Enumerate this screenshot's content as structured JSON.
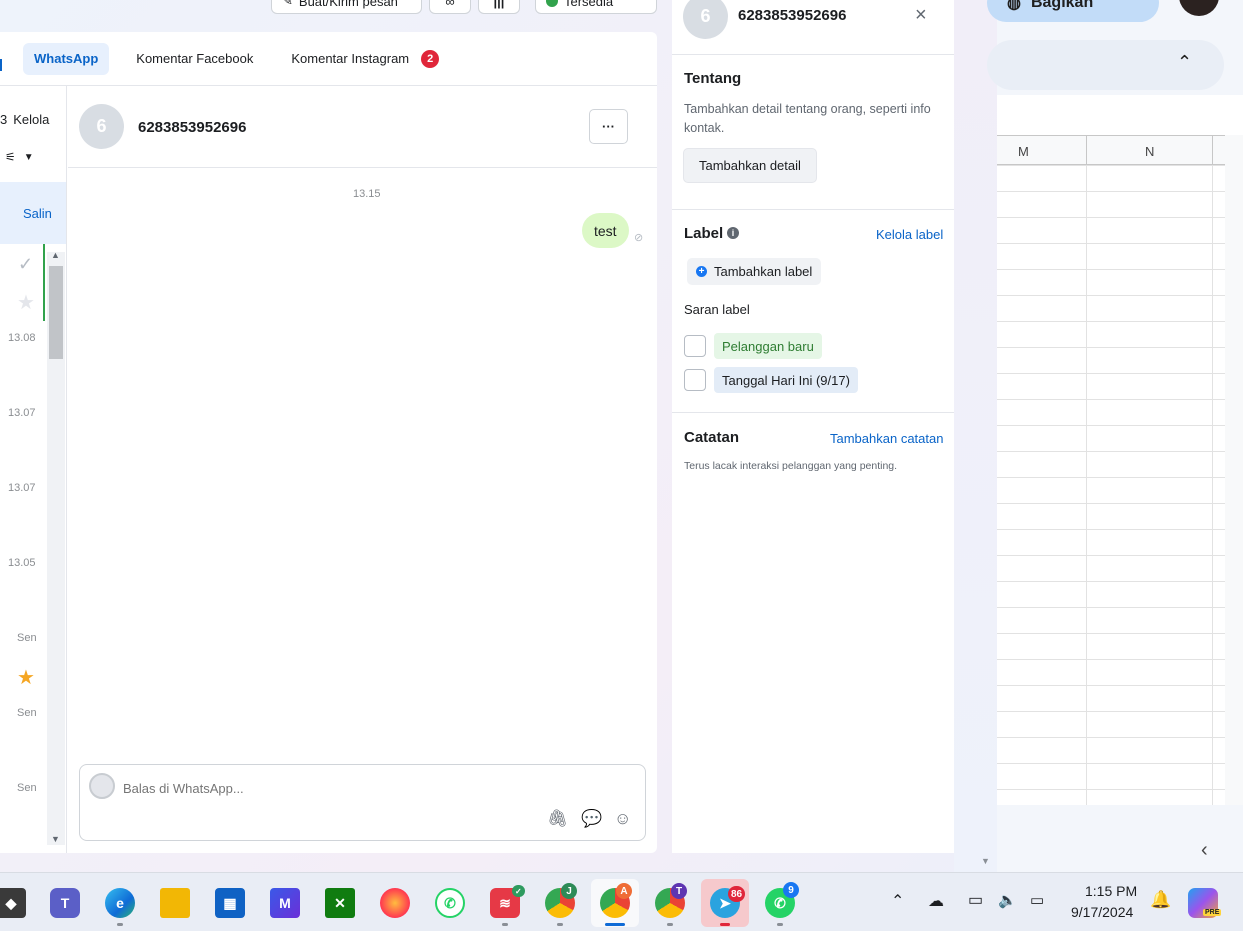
{
  "top": {
    "btn1": "Buat/Kirim pesan",
    "status": "Tersedia"
  },
  "tabs": [
    {
      "label": "WhatsApp",
      "active": true
    },
    {
      "label": "Komentar Facebook",
      "active": false
    },
    {
      "label": "Komentar Instagram",
      "active": false,
      "badge": "2"
    }
  ],
  "list": {
    "manage": "Kelola",
    "copy": "Salin",
    "times": [
      "13.08",
      "13.07",
      "13.07",
      "13.05",
      "Sen",
      "Sen",
      "Sen"
    ]
  },
  "conversation": {
    "avatar_letter": "6",
    "contact": "6283853952696",
    "timestamp": "13.15",
    "message": "test",
    "reply_placeholder": "Balas di WhatsApp..."
  },
  "side": {
    "avatar_letter": "6",
    "contact": "6283853952696",
    "about_title": "Tentang",
    "about_desc": "Tambahkan detail tentang orang, seperti info kontak.",
    "about_btn": "Tambahkan detail",
    "label_title": "Label",
    "manage_label": "Kelola label",
    "add_label": "Tambahkan label",
    "suggest_title": "Saran label",
    "suggestions": [
      "Pelanggan baru",
      "Tanggal Hari Ini (9/17)"
    ],
    "notes_title": "Catatan",
    "add_note": "Tambahkan catatan",
    "notes_desc": "Terus lacak interaksi pelanggan yang penting."
  },
  "sheet": {
    "share": "Bagikan",
    "col_m": "M",
    "col_n": "N"
  },
  "taskbar": {
    "time": "1:15 PM",
    "date": "9/17/2024",
    "telegram_badge": "86",
    "whatsapp_badge": "9",
    "chrome_j": "J",
    "chrome_a": "A",
    "chrome_t": "T",
    "copilot_tag": "PRE",
    "teams_letter": "T"
  },
  "colors": {
    "accent": "#0a64c8",
    "bubble": "#dcf8c6",
    "badge_red": "#e0263a",
    "label_green_bg": "#e5f6e6",
    "label_blue_bg": "#e3ecf7"
  }
}
